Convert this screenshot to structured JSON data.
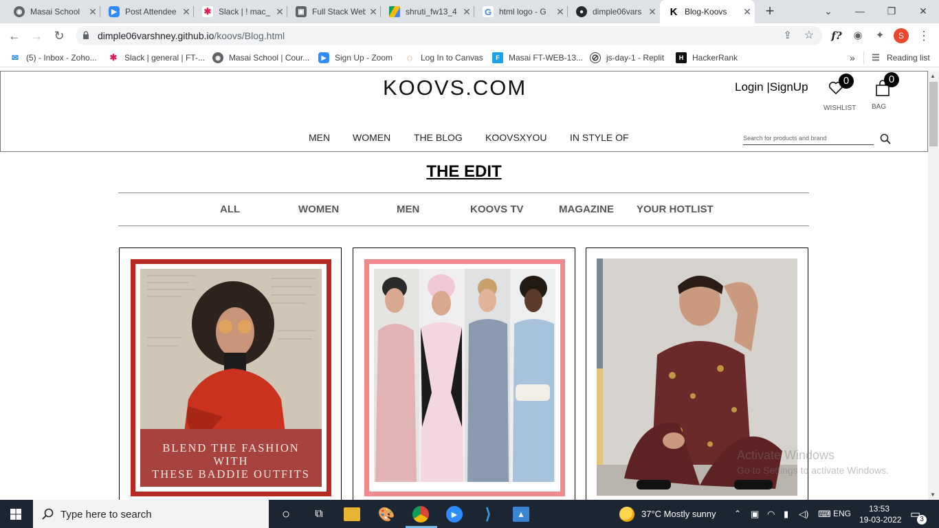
{
  "browser": {
    "tabs": [
      {
        "title": "Masai School",
        "icon": "masai-icon",
        "color": "#3c4043"
      },
      {
        "title": "Post Attendee",
        "icon": "zoom-icon",
        "color": "#2d8cff"
      },
      {
        "title": "Slack | ! mac_",
        "icon": "slack-icon",
        "color": "#e01e5a"
      },
      {
        "title": "Full Stack Web",
        "icon": "vehicle-icon",
        "color": "#5f6368"
      },
      {
        "title": "shruti_fw13_4",
        "icon": "google-drive-icon",
        "color": "#fbbc04"
      },
      {
        "title": "html logo - G",
        "icon": "google-icon",
        "color": "#4285f4"
      },
      {
        "title": "dimple06vars",
        "icon": "github-icon",
        "color": "#24292e"
      },
      {
        "title": "Blog-Koovs",
        "icon": "koovs-icon",
        "color": "#000000"
      }
    ],
    "url_host": "dimple06varshney.github.io",
    "url_path": "/koovs/Blog.html",
    "profile_initial": "S",
    "bookmarks": [
      {
        "label": "(5) - Inbox - Zoho...",
        "icon": "zoho-icon",
        "color": "#1e88e5"
      },
      {
        "label": "Slack | general | FT-...",
        "icon": "slack-icon",
        "color": "#e01e5a"
      },
      {
        "label": "Masai School | Cour...",
        "icon": "masai-icon",
        "color": "#3c4043"
      },
      {
        "label": "Sign Up - Zoom",
        "icon": "zoom-icon",
        "color": "#2d8cff"
      },
      {
        "label": "Log In to Canvas",
        "icon": "canvas-icon",
        "color": "#e13f2b"
      },
      {
        "label": "Masai FT-WEB-13...",
        "icon": "docs-icon",
        "color": "#1aa1e6"
      },
      {
        "label": "js-day-1 - Replit",
        "icon": "replit-icon",
        "color": "#333333"
      },
      {
        "label": "HackerRank",
        "icon": "hackerrank-icon",
        "color": "#111111"
      }
    ],
    "overflow_label": "»",
    "reading_list": "Reading list"
  },
  "site": {
    "logo": "KOOVS.COM",
    "login": "Login",
    "signup": "SignUp",
    "auth_sep": "|",
    "wishlist_count": "0",
    "wishlist_label": "WISHLIST",
    "bag_count": "0",
    "bag_label": "BAG",
    "nav": [
      "MEN",
      "WOMEN",
      "THE BLOG",
      "KOOVSXYOU",
      "IN STYLE OF"
    ],
    "search_placeholder": "Search for products and brand"
  },
  "blog": {
    "title": "THE EDIT",
    "categories": [
      "ALL",
      "WOMEN",
      "MEN",
      "KOOVS TV",
      "MAGAZINE",
      "YOUR HOTLIST"
    ],
    "card1_banner": [
      "BLEND THE FASHION",
      "WITH",
      "THESE BADDIE OUTFITS"
    ]
  },
  "watermark": {
    "line1": "Activate Windows",
    "line2": "Go to Settings to activate Windows."
  },
  "taskbar": {
    "search_placeholder": "Type here to search",
    "weather": "37°C  Mostly sunny",
    "language": "ENG",
    "time": "13:53",
    "date": "19-03-2022",
    "notifications": "3"
  }
}
